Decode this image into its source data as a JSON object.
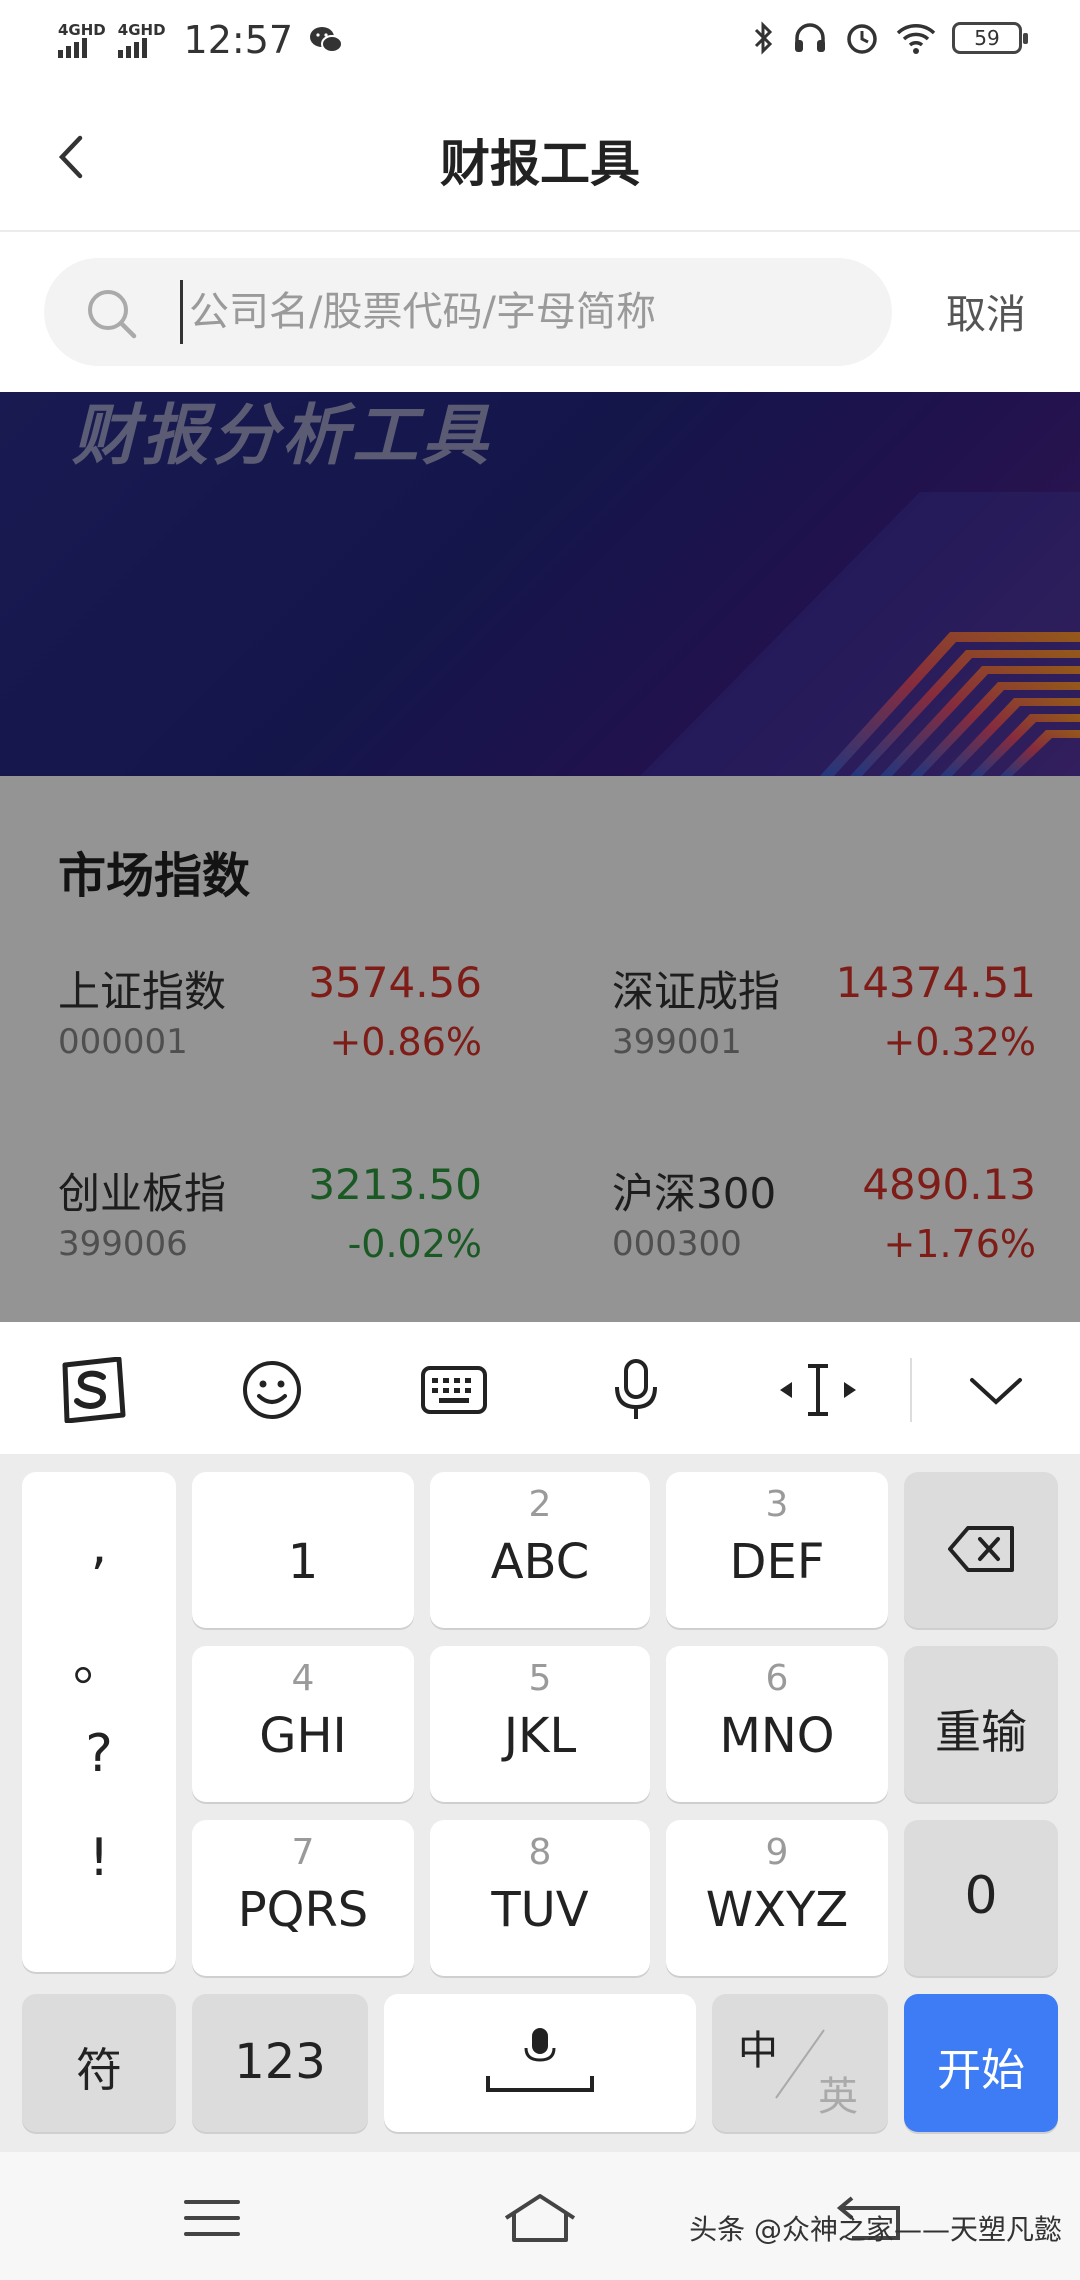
{
  "status_bar": {
    "signal1": "4GHD",
    "signal2": "4GHD",
    "time": "12:57",
    "battery": "59"
  },
  "nav": {
    "title": "财报工具"
  },
  "search": {
    "placeholder": "公司名/股票代码/字母简称",
    "value": "",
    "cancel_label": "取消"
  },
  "banner": {
    "title": "财报分析工具"
  },
  "market": {
    "title": "市场指数",
    "indices": [
      {
        "name": "上证指数",
        "value": "3574.56",
        "code": "000001",
        "change": "+0.86%",
        "trend": "up"
      },
      {
        "name": "深证成指",
        "value": "14374.51",
        "code": "399001",
        "change": "+0.32%",
        "trend": "up"
      },
      {
        "name": "创业板指",
        "value": "3213.50",
        "code": "399006",
        "change": "-0.02%",
        "trend": "down"
      },
      {
        "name": "沪深300",
        "value": "4890.13",
        "code": "000300",
        "change": "+1.76%",
        "trend": "up"
      }
    ]
  },
  "keyboard": {
    "toolbar": [
      "sogou-logo-icon",
      "emoji-icon",
      "keyboard-icon",
      "microphone-icon",
      "cursor-icon",
      "collapse-icon"
    ],
    "punctuation": [
      ",",
      "。",
      "?",
      "!"
    ],
    "keys": [
      {
        "num": "",
        "letters": "1"
      },
      {
        "num": "2",
        "letters": "ABC"
      },
      {
        "num": "3",
        "letters": "DEF"
      },
      {
        "num": "4",
        "letters": "GHI"
      },
      {
        "num": "5",
        "letters": "JKL"
      },
      {
        "num": "6",
        "letters": "MNO"
      },
      {
        "num": "7",
        "letters": "PQRS"
      },
      {
        "num": "8",
        "letters": "TUV"
      },
      {
        "num": "9",
        "letters": "WXYZ"
      }
    ],
    "reinput_label": "重输",
    "zero_label": "0",
    "symbol_label": "符",
    "numeric_label": "123",
    "lang_zh": "中",
    "lang_en": "英",
    "start_label": "开始",
    "start_color": "#3d7cf4"
  },
  "watermark": "头条 @众神之家——天塑凡懿",
  "colors": {
    "up": "#d9322a",
    "down": "#2f9a3e"
  }
}
